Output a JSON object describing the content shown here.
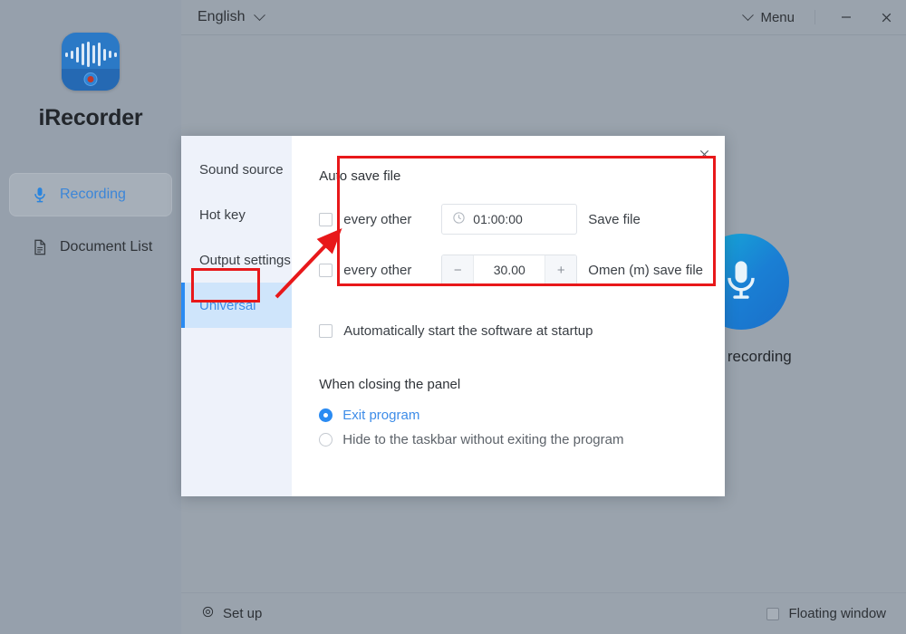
{
  "app": {
    "name": "iRecorder",
    "logo_icon": "waveform-record-icon"
  },
  "sidebar": {
    "items": [
      {
        "label": "Recording",
        "icon": "microphone-icon",
        "active": true
      },
      {
        "label": "Document List",
        "icon": "document-icon",
        "active": false
      }
    ]
  },
  "topbar": {
    "language": "English",
    "language_chevron_icon": "chevron-down-icon",
    "menu_label": "Menu",
    "menu_chevron_icon": "chevron-down-icon",
    "minimize_label": "—",
    "close_label": "✕"
  },
  "background": {
    "record_button_icon": "microphone-icon",
    "record_label": "Start recording"
  },
  "bottombar": {
    "setup_label": "Set up",
    "setup_icon": "gear-icon",
    "floating_window_label": "Floating window",
    "floating_window_checked": false
  },
  "dialog": {
    "close_icon": "close-icon",
    "tabs": [
      {
        "label": "Sound source",
        "active": false
      },
      {
        "label": "Hot key",
        "active": false
      },
      {
        "label": "Output settings",
        "active": false
      },
      {
        "label": "Universal",
        "active": true
      }
    ],
    "auto_save": {
      "title": "Auto save file",
      "rows": [
        {
          "checkbox_checked": false,
          "label": "every other",
          "control": "time-input",
          "icon": "clock-icon",
          "value": "01:00:00",
          "suffix": "Save file"
        },
        {
          "checkbox_checked": false,
          "label": "every other",
          "control": "number-stepper",
          "minus_label": "−",
          "plus_label": "+",
          "value": "30.00",
          "suffix": "Omen (m) save file"
        }
      ]
    },
    "startup": {
      "checkbox_checked": false,
      "label": "Automatically start the software at startup"
    },
    "closing": {
      "title": "When closing the panel",
      "options": [
        {
          "label": "Exit program",
          "selected": true
        },
        {
          "label": "Hide to the taskbar without exiting the program",
          "selected": false
        }
      ]
    }
  },
  "annotations": {
    "highlight_color": "#e8181a",
    "boxes": [
      "auto-save-section",
      "universal-tab"
    ],
    "arrow": "points-from-universal-tab-to-auto-save-section"
  },
  "colors": {
    "window_background": "#9aa3ad",
    "sidebar_background": "#96a0ac",
    "accent_blue": "#2a8bf2",
    "dialog_background": "#ffffff",
    "tab_panel_background": "#eef2fa",
    "active_tab_background": "#cfe5fb"
  }
}
